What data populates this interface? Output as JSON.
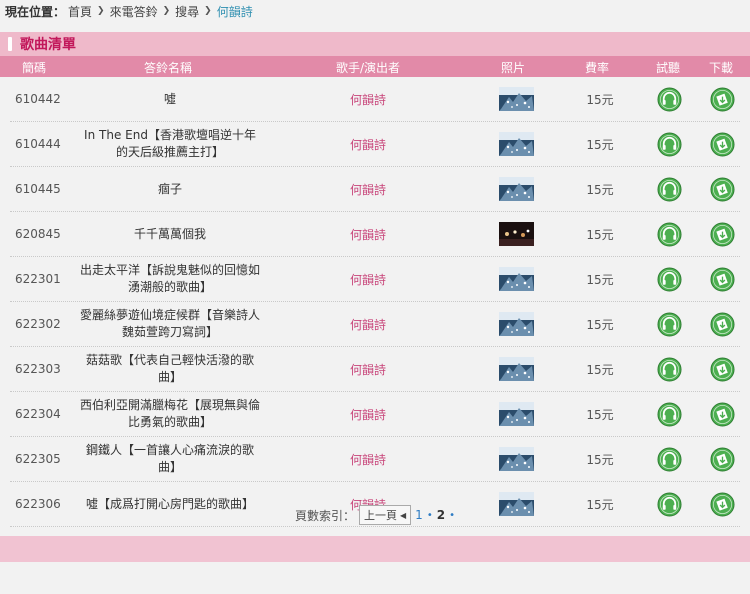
{
  "breadcrumb": {
    "label": "現在位置：",
    "items": [
      "首頁",
      "來電答鈴",
      "搜尋"
    ],
    "current": "何韻詩"
  },
  "panel": {
    "title": "歌曲清單",
    "columns": {
      "code": "簡碼",
      "title": "答鈴名稱",
      "singer": "歌手/演出者",
      "photo": "照片",
      "fee": "費率",
      "listen": "試聽",
      "download": "下載"
    }
  },
  "songs": [
    {
      "code": "610442",
      "title": "噓",
      "singer": "何韻詩",
      "fee": "15元"
    },
    {
      "code": "610444",
      "title": "In The End【香港歌壇唱逆十年的天后級推薦主打】",
      "singer": "何韻詩",
      "fee": "15元"
    },
    {
      "code": "610445",
      "title": "痼子",
      "singer": "何韻詩",
      "fee": "15元"
    },
    {
      "code": "620845",
      "title": "千千萬萬個我",
      "singer": "何韻詩",
      "fee": "15元"
    },
    {
      "code": "622301",
      "title": "出走太平洋【訴說鬼魅似的回憶如湧潮般的歌曲】",
      "singer": "何韻詩",
      "fee": "15元"
    },
    {
      "code": "622302",
      "title": "愛麗絲夢遊仙境症候群【音樂詩人魏茹萱跨刀寫詞】",
      "singer": "何韻詩",
      "fee": "15元"
    },
    {
      "code": "622303",
      "title": "菇菇歌【代表自己輕快活潑的歌曲】",
      "singer": "何韻詩",
      "fee": "15元"
    },
    {
      "code": "622304",
      "title": "西伯利亞開滿臘梅花【展現無與倫比勇氣的歌曲】",
      "singer": "何韻詩",
      "fee": "15元"
    },
    {
      "code": "622305",
      "title": "鋼鐵人【一首讓人心痛流淚的歌曲】",
      "singer": "何韻詩",
      "fee": "15元"
    },
    {
      "code": "622306",
      "title": "噓【成爲打開心房門匙的歌曲】",
      "singer": "何韻詩",
      "fee": "15元"
    }
  ],
  "pager": {
    "label": "頁數索引：",
    "prev": "上一頁",
    "pages": [
      "1",
      "2"
    ],
    "current": "2"
  },
  "colors": {
    "title_bar": "#efb9ca",
    "header_bar": "#e28aa8",
    "singer_text": "#c8457a",
    "icon_green": "#4caf50"
  },
  "icons": {
    "listen": "headphones-icon",
    "download": "download-icon",
    "photo": "album-photo"
  }
}
